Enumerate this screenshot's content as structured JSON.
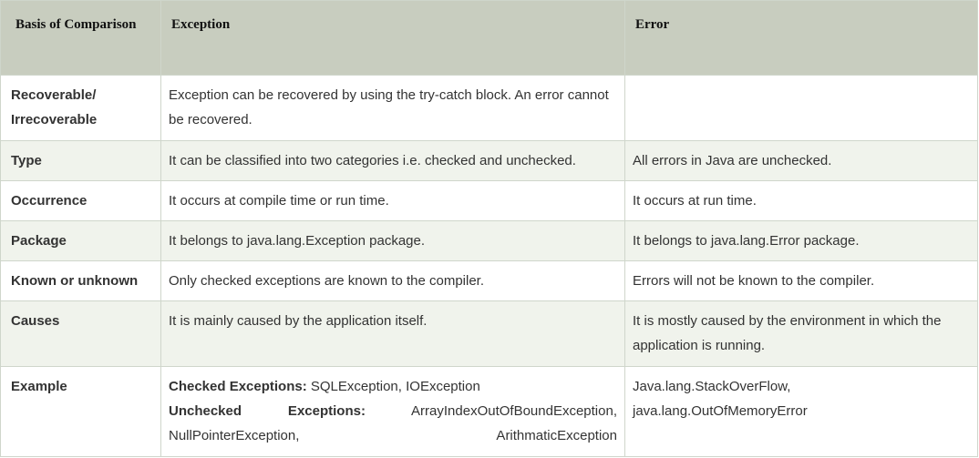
{
  "table": {
    "headers": {
      "basis": "Basis of Comparison",
      "exception": "Exception",
      "error": "Error"
    },
    "rows": [
      {
        "basis": "Recoverable/ Irrecoverable",
        "exception": "Exception can be recovered by using the try-catch block. An error cannot be recovered.",
        "error": ""
      },
      {
        "basis": "Type",
        "exception": "It can be classified into two categories i.e. checked and unchecked.",
        "error": "All errors in Java are unchecked."
      },
      {
        "basis": "Occurrence",
        "exception": "It occurs at compile time or run time.",
        "error": "It occurs at run time."
      },
      {
        "basis": "Package",
        "exception": "It belongs to java.lang.Exception package.",
        "error": "It belongs to java.lang.Error package."
      },
      {
        "basis": "Known or unknown",
        "exception": "Only checked exceptions are known to the compiler.",
        "error": "Errors will not be known to the compiler."
      },
      {
        "basis": "Causes",
        "exception": "It is mainly caused by the application itself.",
        "error": "It is mostly caused by the environment in which the application is running."
      }
    ],
    "example": {
      "basis": "Example",
      "checked_label": "Checked Exceptions:",
      "checked_value": " SQLException, IOException",
      "unchecked_label": "Unchecked Exceptions:",
      "unchecked_value": "ArrayIndexOutOfBoundException, NullPointerException, ArithmaticException",
      "error_line1": "Java.lang.StackOverFlow,",
      "error_line2": "java.lang.OutOfMemoryError"
    }
  }
}
